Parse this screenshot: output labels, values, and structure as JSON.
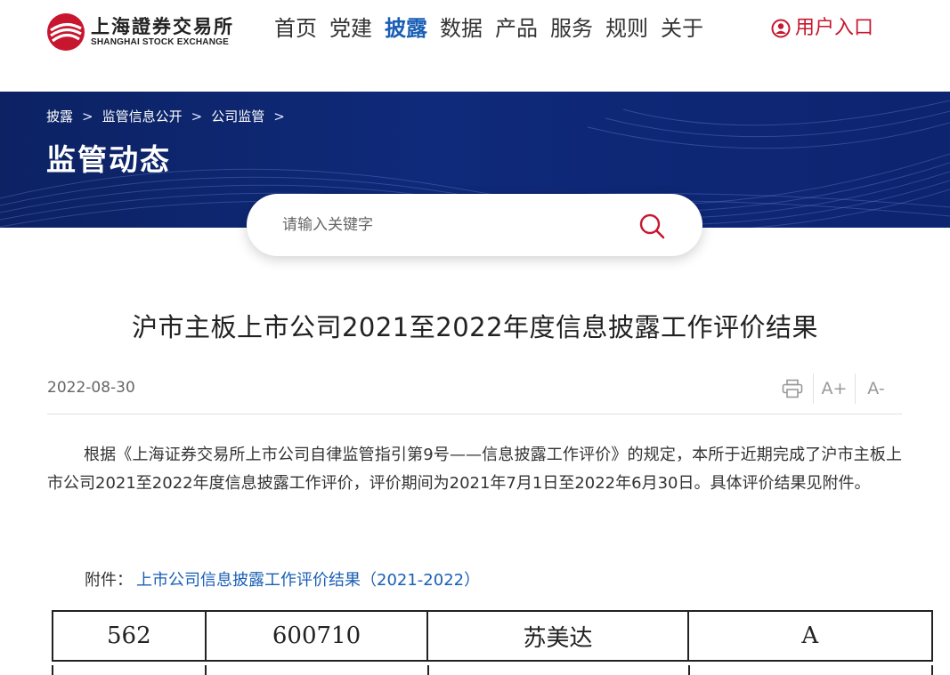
{
  "brand": {
    "name_cn": "上海證券交易所",
    "name_en": "SHANGHAI STOCK EXCHANGE",
    "accent": "#c8162e"
  },
  "nav": {
    "items": [
      {
        "label": "首页",
        "active": false
      },
      {
        "label": "党建",
        "active": false
      },
      {
        "label": "披露",
        "active": true
      },
      {
        "label": "数据",
        "active": false
      },
      {
        "label": "产品",
        "active": false
      },
      {
        "label": "服务",
        "active": false
      },
      {
        "label": "规则",
        "active": false
      },
      {
        "label": "关于",
        "active": false
      }
    ],
    "active_color": "#1a5fb4"
  },
  "user_entry": {
    "label": "用户入口"
  },
  "breadcrumb": [
    "披露",
    "监管信息公开",
    "公司监管"
  ],
  "banner": {
    "title": "监管动态"
  },
  "search": {
    "placeholder": "请输入关键字"
  },
  "article": {
    "title": "沪市主板上市公司2021至2022年度信息披露工作评价结果",
    "date": "2022-08-30",
    "tools": {
      "print": "print-icon",
      "font_up": "A+",
      "font_down": "A-"
    },
    "body": "根据《上海证券交易所上市公司自律监管指引第9号——信息披露工作评价》的规定，本所于近期完成了沪市主板上市公司2021至2022年度信息披露工作评价，评价期间为2021年7月1日至2022年6月30日。具体评价结果见附件。",
    "attachment": {
      "prefix": "附件：",
      "link": "上市公司信息披露工作评价结果（2021-2022）"
    }
  },
  "table_fragment": {
    "row": [
      "562",
      "600710",
      "苏美达",
      "A"
    ]
  }
}
